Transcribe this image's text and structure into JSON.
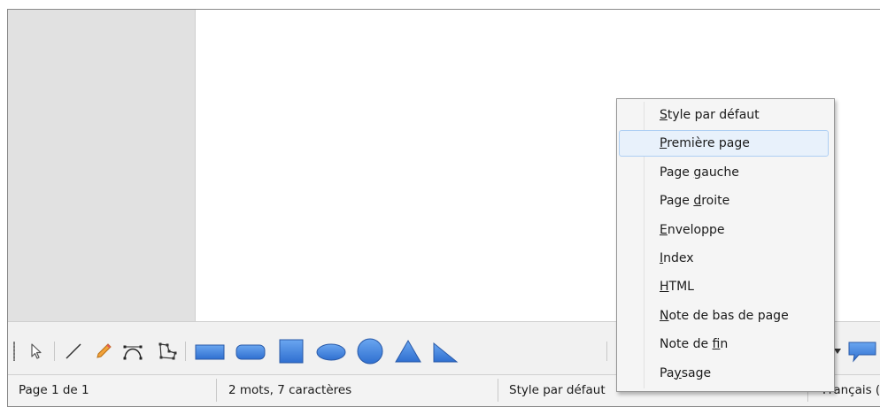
{
  "status_bar": {
    "page": "Page 1 de 1",
    "words": "2 mots, 7 caractères",
    "page_style": "Style par défaut",
    "language": "Français ("
  },
  "drawing_toolbar": {
    "tools": [
      "select-icon",
      "line-icon",
      "freeform-line-icon",
      "curve-icon",
      "polygon-icon",
      "rectangle-icon",
      "rounded-rectangle-icon",
      "square-icon",
      "ellipse-icon",
      "circle-icon",
      "isosceles-triangle-icon",
      "right-triangle-icon",
      "callout-icon"
    ],
    "accent_color": "#3a7bd5"
  },
  "page_style_menu": {
    "items": [
      {
        "pre": "",
        "key": "S",
        "post": "tyle par défaut"
      },
      {
        "pre": "",
        "key": "P",
        "post": "remière page"
      },
      {
        "pre": "Page ",
        "key": "g",
        "post": "auche"
      },
      {
        "pre": "Page ",
        "key": "d",
        "post": "roite"
      },
      {
        "pre": "",
        "key": "E",
        "post": "nveloppe"
      },
      {
        "pre": "",
        "key": "I",
        "post": "ndex"
      },
      {
        "pre": "",
        "key": "H",
        "post": "TML"
      },
      {
        "pre": "",
        "key": "N",
        "post": "ote de bas de page"
      },
      {
        "pre": "Note de ",
        "key": "f",
        "post": "in"
      },
      {
        "pre": "Pa",
        "key": "y",
        "post": "sage"
      }
    ],
    "highlighted_index": 1
  }
}
